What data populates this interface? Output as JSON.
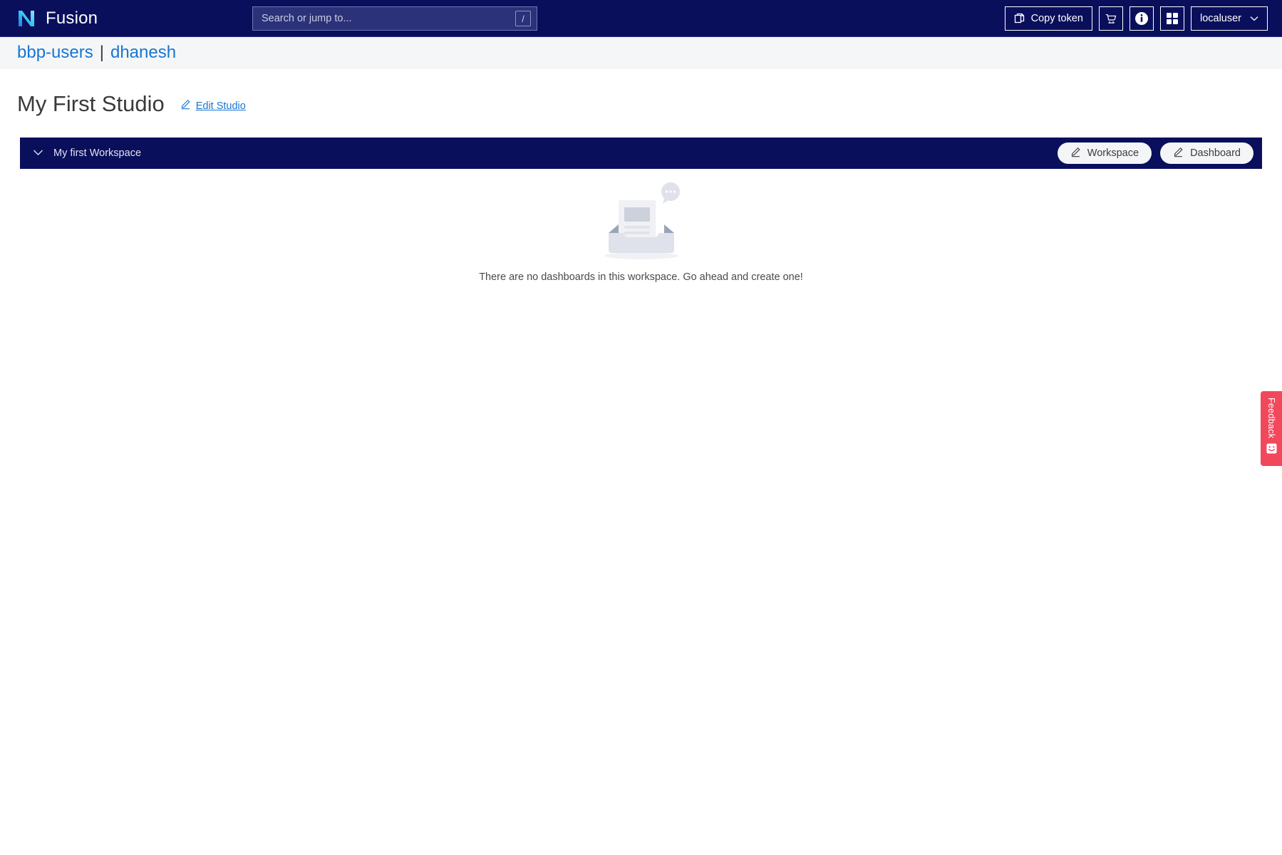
{
  "topbar": {
    "logo_icon": "fusion-n-logo-icon",
    "brand_name": "Fusion",
    "search": {
      "placeholder": "Search or jump to...",
      "value": "",
      "shortcut_key": "/"
    },
    "copy_token_label": "Copy token",
    "copy_token_icon": "copy-icon",
    "cart_icon": "shopping-cart-icon",
    "info_icon": "info-circle-icon",
    "apps_icon": "grid-apps-icon",
    "user_label": "localuser",
    "user_chevron_icon": "chevron-down-icon"
  },
  "breadcrumb": {
    "org": "bbp-users",
    "separator": "|",
    "project": "dhanesh"
  },
  "page": {
    "title": "My First Studio",
    "edit_label": "Edit Studio",
    "edit_icon": "pencil-icon"
  },
  "workspace": {
    "expand_icon": "chevron-down-icon",
    "name": "My first Workspace",
    "edit_workspace_label": "Workspace",
    "edit_workspace_icon": "pencil-icon",
    "edit_dashboard_label": "Dashboard",
    "edit_dashboard_icon": "pencil-icon"
  },
  "empty_state": {
    "illustration": "empty-inbox-illustration",
    "message": "There are no dashboards in this workspace. Go ahead and create one!"
  },
  "feedback": {
    "label": "Feedback",
    "icon": "smiley-face-icon"
  },
  "colors": {
    "navy": "#0a0f5c",
    "link_blue": "#1677d4",
    "feedback_red": "#f2485b",
    "logo_cyan": "#2ec4f3",
    "page_bg": "#ffffff",
    "crumb_bg": "#f5f6f7"
  }
}
